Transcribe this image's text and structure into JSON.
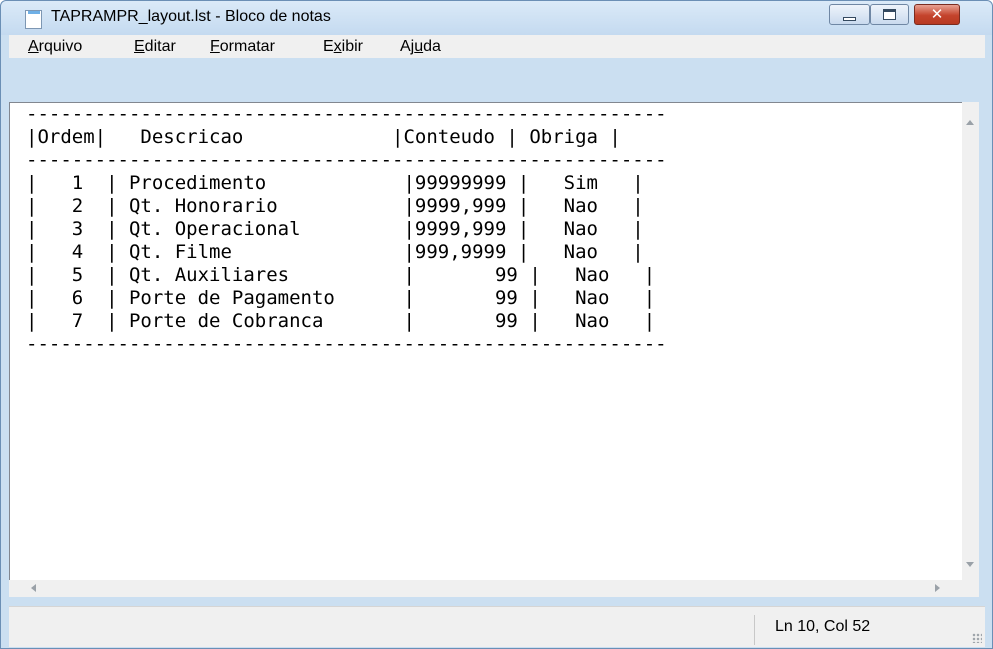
{
  "window": {
    "title": "TAPRAMPR_layout.lst - Bloco de notas"
  },
  "menu": [
    {
      "pre": "",
      "acc": "A",
      "post": "rquivo"
    },
    {
      "pre": "",
      "acc": "E",
      "post": "ditar"
    },
    {
      "pre": "",
      "acc": "F",
      "post": "ormatar"
    },
    {
      "pre": "E",
      "acc": "x",
      "post": "ibir"
    },
    {
      "pre": "Aj",
      "acc": "u",
      "post": "da"
    }
  ],
  "content": {
    "text": "--------------------------------------------------------\n|Ordem|   Descricao             |Conteudo | Obriga |\n--------------------------------------------------------\n|   1  | Procedimento            |99999999 |   Sim   |\n|   2  | Qt. Honorario           |9999,999 |   Nao   |\n|   3  | Qt. Operacional         |9999,999 |   Nao   |\n|   4  | Qt. Filme               |999,9999 |   Nao   |\n|   5  | Qt. Auxiliares          |       99 |   Nao   |\n|   6  | Porte de Pagamento      |       99 |   Nao   |\n|   7  | Porte de Cobranca       |       99 |   Nao   |\n--------------------------------------------------------"
  },
  "status": {
    "position": "Ln 10, Col 52"
  }
}
